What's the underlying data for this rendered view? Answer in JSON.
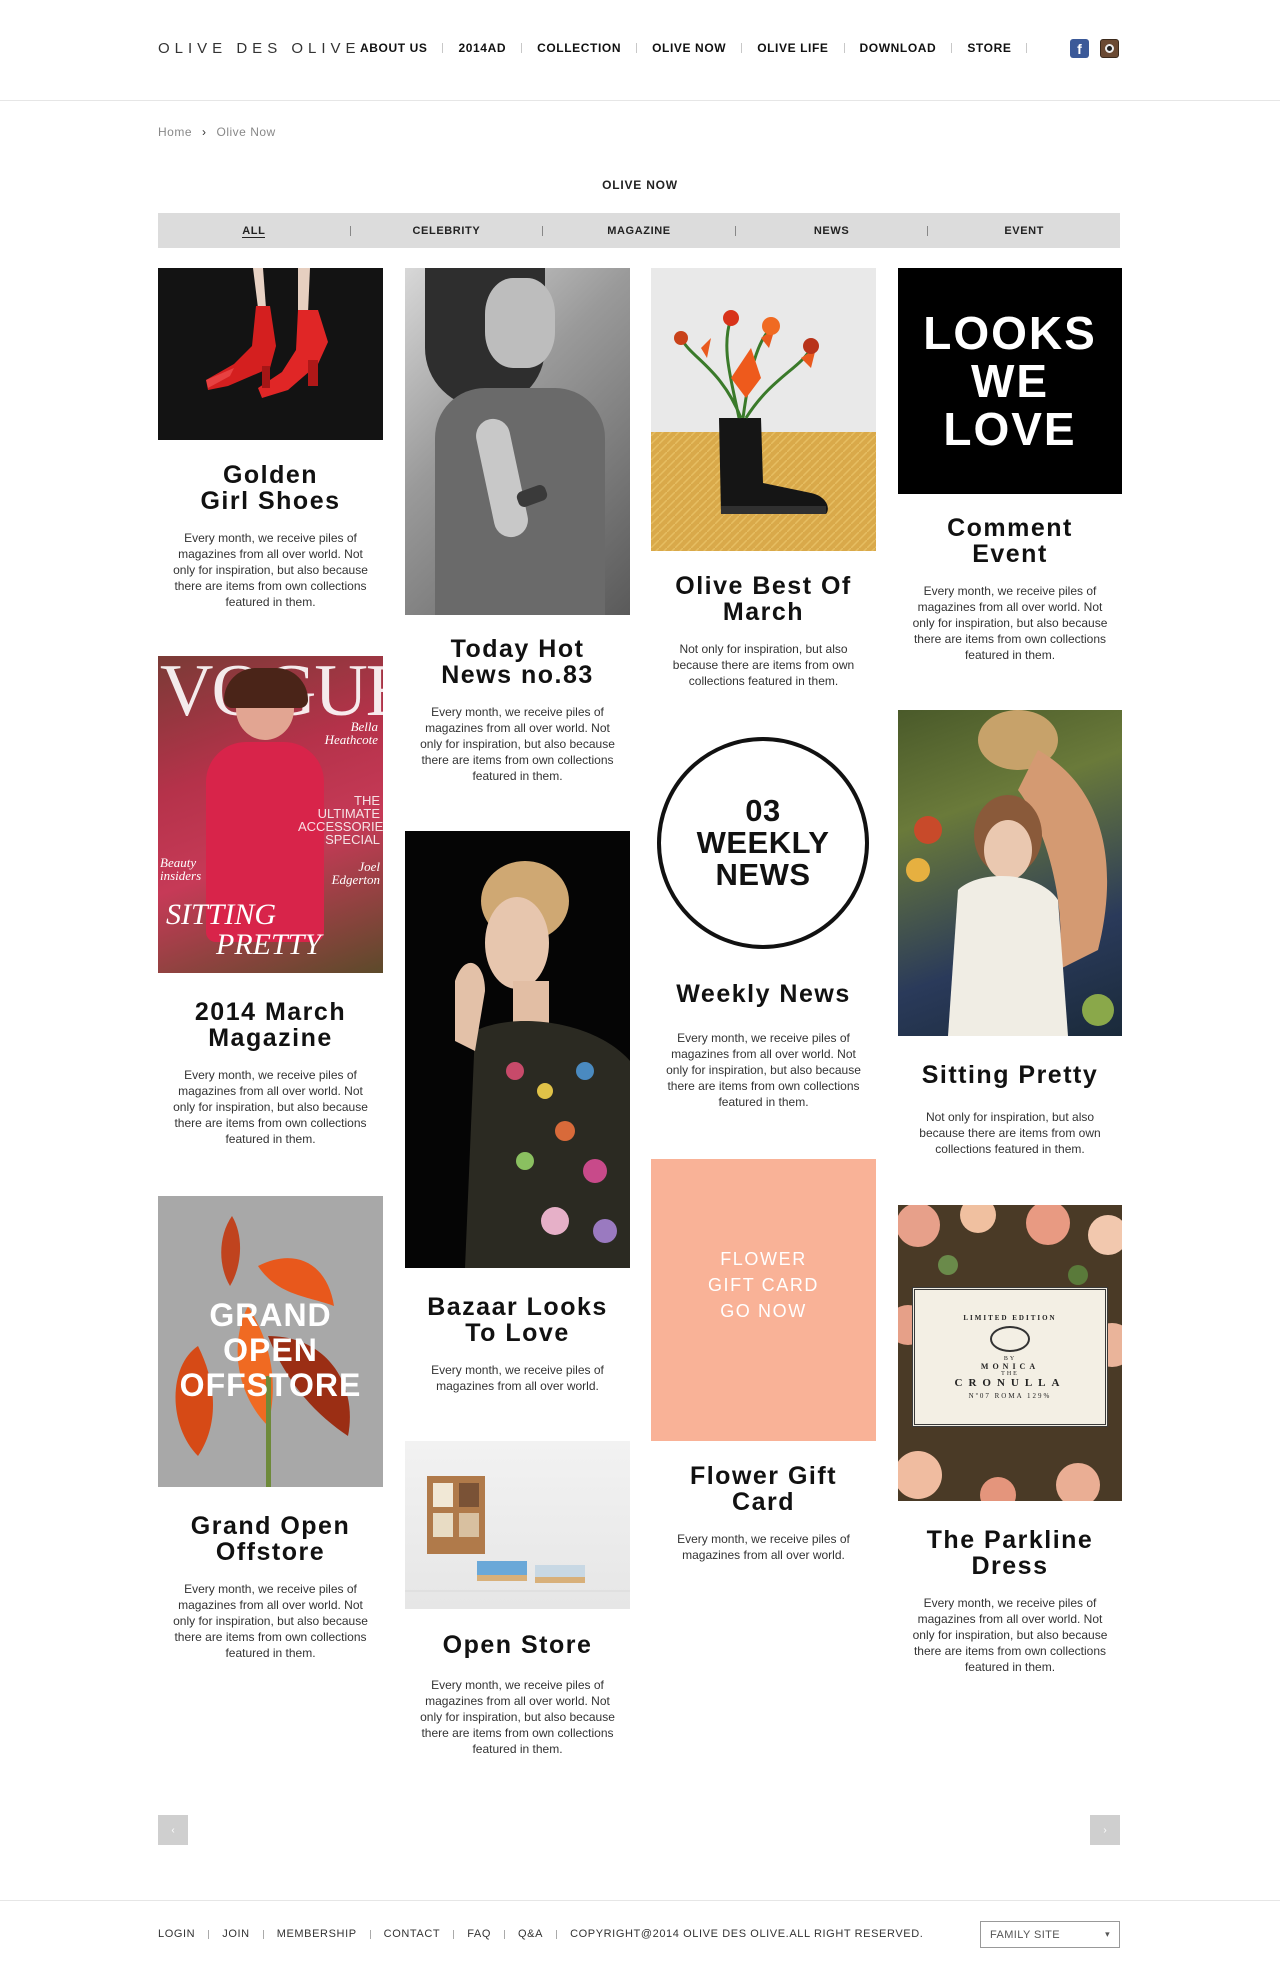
{
  "header": {
    "logo": "OLIVE DES OLIVE",
    "nav": [
      "ABOUT US",
      "2014AD",
      "COLLECTION",
      "OLIVE NOW",
      "OLIVE LIFE",
      "DOWNLOAD",
      "STORE"
    ],
    "social": {
      "facebook": "facebook-icon",
      "instagram": "instagram-icon"
    }
  },
  "breadcrumb": {
    "home": "Home",
    "separator": "›",
    "current": "Olive Now"
  },
  "page_title": "OLIVE NOW",
  "filters": {
    "items": [
      "ALL",
      "CELEBRITY",
      "MAGAZINE",
      "NEWS",
      "EVENT"
    ],
    "active": "ALL"
  },
  "cards": {
    "golden_girl": {
      "title_1": "Golden",
      "title_2": "Girl Shoes",
      "body": "Every month, we receive piles of magazines from all over world. Not only for inspiration, but also because there are items from own collections featured in them."
    },
    "march_magazine": {
      "title_1": "2014 March",
      "title_2": "Magazine",
      "body": "Every month, we receive piles of magazines from all over world. Not only for inspiration, but also because there are items from own collections featured in them.",
      "cover": {
        "masthead": "VOGUE",
        "tag_1": "Bella",
        "tag_2": "Heathcote",
        "line_1": "THE",
        "line_2": "ULTIMATE",
        "line_3": "ACCESSORIES",
        "line_4": "SPECIAL",
        "left_1": "Beauty",
        "left_2": "insiders",
        "right_1": "Joel",
        "right_2": "Edgerton",
        "headline_1": "SITTING",
        "headline_2": "PRETTY"
      }
    },
    "grand_open": {
      "title_1": "Grand Open",
      "title_2": "Offstore",
      "body": "Every month, we receive piles of magazines from all over world. Not only for inspiration, but also because there are items from own collections featured in them.",
      "poster": {
        "line_1": "GRAND",
        "line_2": "OPEN",
        "line_3": "OFFSTORE"
      }
    },
    "today_hot": {
      "title_1": "Today Hot",
      "title_2": "News no.83",
      "body": "Every month, we receive piles of magazines from all over world. Not only for inspiration, but also because there are items from own collections featured in them."
    },
    "bazaar": {
      "title_1": "Bazaar Looks",
      "title_2": "To Love",
      "body": "Every month, we receive piles of magazines from all over world."
    },
    "open_store": {
      "title_1": "Open Store",
      "body": "Every month, we receive piles of magazines from all over world. Not only for inspiration, but also because there are items from own collections featured in them."
    },
    "best_of_march": {
      "title_1": "Olive Best Of",
      "title_2": "March",
      "body": "Not only for inspiration, but also because there are items from own collections featured in them."
    },
    "weekly_news": {
      "title_1": "Weekly News",
      "body": "Every month, we receive piles of magazines from all over world. Not only for inspiration, but also because there are items from own collections featured in them.",
      "badge": {
        "line_1": "03",
        "line_2": "WEEKLY",
        "line_3": "NEWS"
      }
    },
    "flower_gift": {
      "title_1": "Flower Gift",
      "title_2": "Card",
      "body": "Every month, we receive piles of magazines from all over world.",
      "tile": {
        "line_1": "FLOWER",
        "line_2": "GIFT CARD",
        "line_3": "GO NOW"
      }
    },
    "comment_event": {
      "title_1": "Comment",
      "title_2": "Event",
      "body": "Every month, we receive piles of magazines from all over world. Not only for inspiration, but also because there are items from own collections featured in them.",
      "tile": {
        "line_1": "LOOKS",
        "line_2": "WE",
        "line_3": "LOVE"
      }
    },
    "sitting_pretty": {
      "title_1": "Sitting Pretty",
      "body": "Not only for inspiration, but also because there are items from own collections featured in them."
    },
    "parkline": {
      "title_1": "The Parkline",
      "title_2": "Dress",
      "body": "Every month, we receive piles of magazines from all over world. Not only for inspiration, but also because there are items from own collections featured in them.",
      "label": {
        "top": "LIMITED EDITION",
        "by": "BY",
        "brand_1": "MONICA",
        "the": "THE",
        "brand_2": "CRONULLA",
        "place": "Nº07 ROMA 129%"
      }
    }
  },
  "pager": {
    "prev": "‹",
    "next": "›"
  },
  "footer": {
    "links": [
      "LOGIN",
      "JOIN",
      "MEMBERSHIP",
      "CONTACT",
      "FAQ",
      "Q&A"
    ],
    "copyright": "COPYRIGHT@2014 OLIVE DES OLIVE.ALL RIGHT RESERVED.",
    "family_site": "FAMILY SITE",
    "family_icon": "chevron-down-icon"
  },
  "colors": {
    "filter_bar": "#dcdcdc",
    "flower_tile": "#f9b094",
    "accent_dark": "#000000",
    "boot_red": "#d42020"
  }
}
